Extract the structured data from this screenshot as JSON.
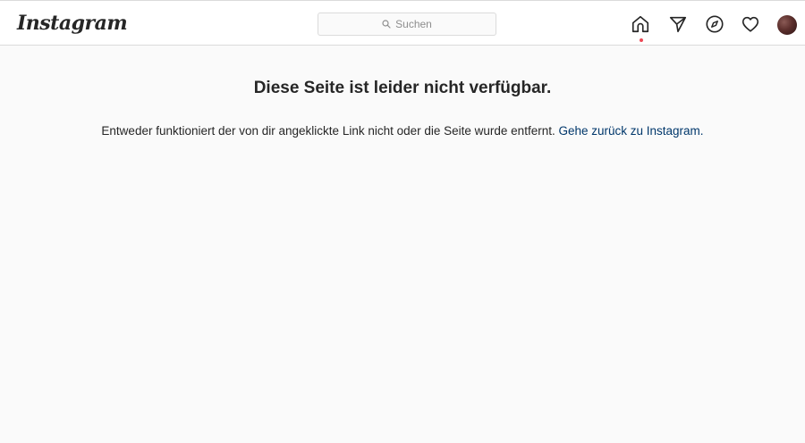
{
  "header": {
    "logo_text": "Instagram",
    "search_placeholder": "Suchen",
    "icons": [
      "home-icon",
      "direct-message-icon",
      "explore-icon",
      "activity-heart-icon",
      "profile-avatar"
    ],
    "home_active_dot_color": "#ed4956"
  },
  "main": {
    "title": "Diese Seite ist leider nicht verfügbar.",
    "message_text": "Entweder funktioniert der von dir angeklickte Link nicht oder die Seite wurde entfernt.",
    "link_text": "Gehe zurück zu Instagram."
  },
  "colors": {
    "background": "#fafafa",
    "link": "#00376b",
    "text": "#262626"
  }
}
